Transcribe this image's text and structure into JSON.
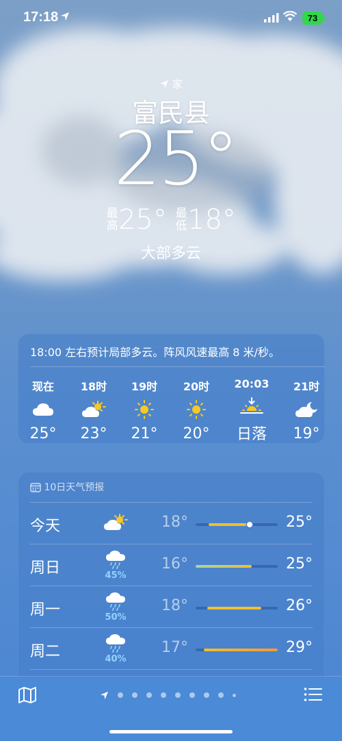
{
  "status": {
    "time": "17:18",
    "battery": "73"
  },
  "location": {
    "tag": "家",
    "city": "富民县"
  },
  "current": {
    "temp": "25°",
    "high_tag": "最高",
    "high": "25°",
    "low_tag": "最低",
    "low": "18°",
    "condition": "大部多云"
  },
  "hourly": {
    "summary": "18:00 左右预计局部多云。阵风风速最高 8 米/秒。",
    "items": [
      {
        "label": "现在",
        "icon": "cloud-icon",
        "value": "25°"
      },
      {
        "label": "18时",
        "icon": "partly-sunny-icon",
        "value": "23°"
      },
      {
        "label": "19时",
        "icon": "sun-icon",
        "value": "21°"
      },
      {
        "label": "20时",
        "icon": "sun-icon",
        "value": "20°"
      },
      {
        "label": "20:03",
        "icon": "sunset-icon",
        "value": "日落"
      },
      {
        "label": "21时",
        "icon": "moon-cloud-icon",
        "value": "19°"
      }
    ]
  },
  "daily": {
    "header": "10日天气预报",
    "days": [
      {
        "day": "今天",
        "icon": "partly-sunny-icon",
        "precip": "",
        "low": "18°",
        "high": "25°",
        "bar": [
          0.16,
          0.68
        ],
        "current": 0.66
      },
      {
        "day": "周日",
        "icon": "rain-cloud-icon",
        "precip": "45%",
        "low": "16°",
        "high": "25°",
        "bar": [
          0.0,
          0.68
        ]
      },
      {
        "day": "周一",
        "icon": "rain-cloud-icon",
        "precip": "50%",
        "low": "18°",
        "high": "26°",
        "bar": [
          0.14,
          0.8
        ]
      },
      {
        "day": "周二",
        "icon": "rain-cloud-icon",
        "precip": "40%",
        "low": "17°",
        "high": "29°",
        "bar": [
          0.1,
          1.0
        ]
      }
    ]
  },
  "colors": {
    "bar_cool": "#a8d5a0",
    "bar_warm": "#f2c029",
    "bar_hot": "#f29a3a",
    "precip": "#8fd3ff"
  }
}
